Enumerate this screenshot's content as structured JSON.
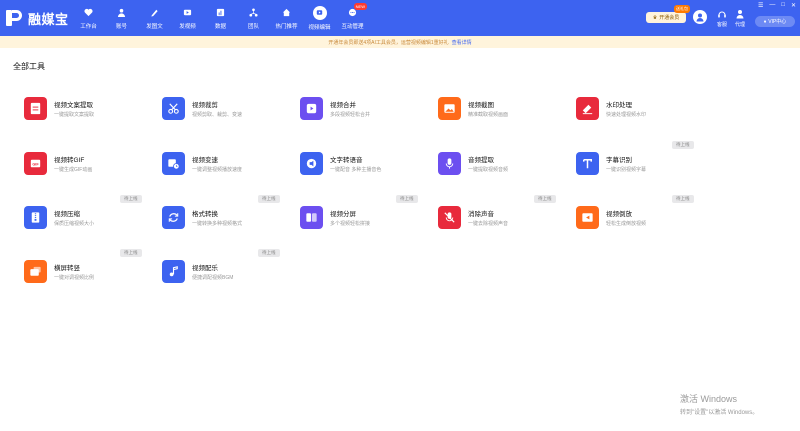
{
  "app": {
    "logo_text": "融媒宝"
  },
  "nav": [
    {
      "label": "工作台",
      "icon": "heart-icon"
    },
    {
      "label": "账号",
      "icon": "user-icon"
    },
    {
      "label": "发图文",
      "icon": "pen-icon"
    },
    {
      "label": "发视频",
      "icon": "video-icon"
    },
    {
      "label": "数据",
      "icon": "chart-icon"
    },
    {
      "label": "团队",
      "icon": "team-icon"
    },
    {
      "label": "热门推荐",
      "icon": "home-icon"
    },
    {
      "label": "视频编辑",
      "icon": "edit-icon"
    },
    {
      "label": "互动管理",
      "icon": "message-icon",
      "badge": "NEW"
    }
  ],
  "header": {
    "vip_button": "开通会员",
    "vip_tag": "送礼包",
    "service_label": "客服",
    "agent_label": "代理",
    "vip_center": "VIP中心"
  },
  "notice": {
    "text": "开通年会员即送4项AI工具会员，运营视频编辑1重好礼",
    "link": "查看详情"
  },
  "section_title": "全部工具",
  "tools": [
    {
      "title": "视频文案提取",
      "desc": "一键提取文案提取",
      "color": "#e82a3c",
      "icon": "doc-icon",
      "tag": ""
    },
    {
      "title": "视频裁剪",
      "desc": "视频剪取、裁剪、变速",
      "color": "#3d63f0",
      "icon": "scissors-icon",
      "tag": ""
    },
    {
      "title": "视频合并",
      "desc": "多段视频轻松合并",
      "color": "#6c4ff0",
      "icon": "play-icon",
      "tag": ""
    },
    {
      "title": "视频截图",
      "desc": "精准截取视频画面",
      "color": "#ff6a1a",
      "icon": "image-icon",
      "tag": ""
    },
    {
      "title": "水印处理",
      "desc": "快速处理视频水印",
      "color": "#e82a3c",
      "icon": "eraser-icon",
      "tag": ""
    },
    {
      "title": "视频转GIF",
      "desc": "一键生成GIF动画",
      "color": "#e82a3c",
      "icon": "gif-icon",
      "tag": ""
    },
    {
      "title": "视频变速",
      "desc": "一键调整视频播放速度",
      "color": "#3d63f0",
      "icon": "speed-icon",
      "tag": ""
    },
    {
      "title": "文字转语音",
      "desc": "一键配音 多种主播音色",
      "color": "#3d63f0",
      "icon": "audio-icon",
      "tag": ""
    },
    {
      "title": "音频提取",
      "desc": "一键提取视频音频",
      "color": "#6c4ff0",
      "icon": "mic-icon",
      "tag": ""
    },
    {
      "title": "字幕识别",
      "desc": "一键识别视频字幕",
      "color": "#3d63f0",
      "icon": "text-icon",
      "tag": "待上线"
    },
    {
      "title": "视频压缩",
      "desc": "保质压缩视频大小",
      "color": "#3d63f0",
      "icon": "zip-icon",
      "tag": "待上线"
    },
    {
      "title": "格式转换",
      "desc": "一键转换多种视频格式",
      "color": "#3d63f0",
      "icon": "convert-icon",
      "tag": "待上线"
    },
    {
      "title": "视频分屏",
      "desc": "多个视频轻松拼接",
      "color": "#6c4ff0",
      "icon": "split-icon",
      "tag": "待上线"
    },
    {
      "title": "消除声音",
      "desc": "一键去除视频声音",
      "color": "#e82a3c",
      "icon": "mute-icon",
      "tag": "待上线"
    },
    {
      "title": "视频倒放",
      "desc": "轻松生成倒放视频",
      "color": "#ff6a1a",
      "icon": "reverse-icon",
      "tag": "待上线"
    },
    {
      "title": "横屏转竖",
      "desc": "一键对调视频比例",
      "color": "#ff6a1a",
      "icon": "rotate-icon",
      "tag": "待上线"
    },
    {
      "title": "视频配乐",
      "desc": "便捷调配视频BGM",
      "color": "#3d63f0",
      "icon": "music-icon",
      "tag": "待上线"
    }
  ],
  "watermark": {
    "line1": "激活 Windows",
    "line2": "转到\"设置\"以激活 Windows。"
  }
}
